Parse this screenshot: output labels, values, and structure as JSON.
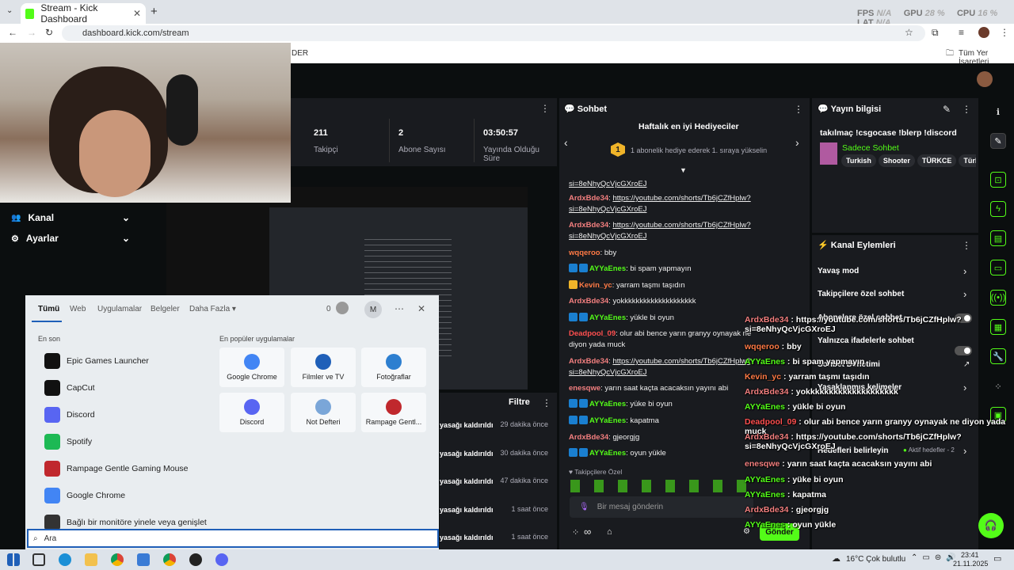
{
  "browser": {
    "tab_title": "Stream - Kick Dashboard",
    "url": "dashboard.kick.com/stream",
    "bookmarks_label": "Tüm Yer İşaretleri",
    "bookmark_fragment": "DER"
  },
  "perf_overlay": {
    "fps_label": "FPS",
    "fps_value": "N/A",
    "gpu_label": "GPU",
    "gpu_value": "28 %",
    "cpu_label": "CPU",
    "cpu_value": "16 %",
    "lat_label": "LAT",
    "lat_value": "N/A"
  },
  "stats": [
    {
      "value": "211",
      "label": "Takipçi"
    },
    {
      "value": "2",
      "label": "Abone Sayısı"
    },
    {
      "value": "03:50:57",
      "label": "Yayında Olduğu Süre"
    }
  ],
  "sidebar": {
    "items": [
      {
        "label": "Kanal",
        "icon": "people-icon"
      },
      {
        "label": "Ayarlar",
        "icon": "gear-icon"
      }
    ]
  },
  "activity": {
    "filter_label": "Filtre",
    "rows": [
      {
        "text": "yasağı kaldırıldı",
        "time": "29 dakika önce"
      },
      {
        "text": "yasağı kaldırıldı",
        "time": "30 dakika önce"
      },
      {
        "text": "yasağı kaldırıldı",
        "time": "47 dakika önce"
      },
      {
        "text": "yasağı kaldırıldı",
        "time": "1 saat önce"
      },
      {
        "text": "yasağı kaldırıldı",
        "time": "1 saat önce"
      }
    ]
  },
  "chat": {
    "title": "Sohbet",
    "gifters_title": "Haftalık en iyi Hediyeciler",
    "gifters_rank": "1",
    "gifters_text": "1 abonelik hediye ederek 1. sıraya yükselin",
    "messages": [
      {
        "user": "",
        "text": "si=8eNhyQcVjcGXroEJ",
        "link": true
      },
      {
        "user": "ArdxBde34",
        "text": "https://youtube.com/shorts/Tb6jCZfHplw?si=8eNhyQcVjcGXroEJ",
        "link": true
      },
      {
        "user": "ArdxBde34",
        "text": "https://youtube.com/shorts/Tb6jCZfHplw?si=8eNhyQcVjcGXroEJ",
        "link": true
      },
      {
        "user": "wqqeroo",
        "text": "bby"
      },
      {
        "user": "AYYaEnes",
        "text": "bi spam yapmayın"
      },
      {
        "user": "Kevin_yc",
        "text": "yarram taşmı taşıdın"
      },
      {
        "user": "ArdxBde34",
        "text": "yokkkkkkkkkkkkkkkkkkkk"
      },
      {
        "user": "AYYaEnes",
        "text": "yükle bi oyun"
      },
      {
        "user": "Deadpool_09",
        "text": "olur abi bence yarın granyy oynayak ne diyon yada muck"
      },
      {
        "user": "ArdxBde34",
        "text": "https://youtube.com/shorts/Tb6jCZfHplw?si=8eNhyQcVjcGXroEJ",
        "link": true
      },
      {
        "user": "enesqwe",
        "text": "yarın saat kaçta acacaksın yayını abi"
      },
      {
        "user": "AYYaEnes",
        "text": "yüke bi oyun"
      },
      {
        "user": "AYYaEnes",
        "text": "kapatma"
      },
      {
        "user": "ArdxBde34",
        "text": "gjeorgjg"
      },
      {
        "user": "AYYaEnes",
        "text": "oyun yükle"
      }
    ],
    "followers_only": "Takipçilere Özel",
    "input_placeholder": "Bir mesaj gönderin",
    "send_label": "Gönder",
    "infinity": "∞"
  },
  "stream_info": {
    "title": "Yayın bilgisi",
    "stream_title": "takılmaç !csgocase !blerp !discord",
    "category": "Sadece Sohbet",
    "tags": [
      "Turkish",
      "Shooter",
      "TÜRKCE",
      "Türk"
    ]
  },
  "channel_actions": {
    "title": "Kanal Eylemleri",
    "items": [
      {
        "label": "Yavaş mod"
      },
      {
        "label": "Takipçilere özel sohbet"
      },
      {
        "label": "Abonelere özel sohbet"
      },
      {
        "label": "Yalnızca ifadelerle sohbet"
      },
      {
        "label": "Sohbet Denetimi"
      },
      {
        "label": "Yasaklanmış kelimeler"
      },
      {
        "label": "Hedefleri belirleyin"
      }
    ],
    "active_goals": "Aktif hedefler - 2"
  },
  "overlay_chat": [
    {
      "user": "ArdxBde34",
      "text": "https://youtube.com/shorts/Tb6jCZfHplw?si=8eNhyQcVjcGXroEJ"
    },
    {
      "user": "wqqeroo",
      "text": "bby"
    },
    {
      "user": "AYYaEnes",
      "text": "bi spam yapmayın"
    },
    {
      "user": "Kevin_yc",
      "text": "yarram taşmı taşıdın"
    },
    {
      "user": "ArdxBde34",
      "text": "yokkkkkkkkkkkkkkkkkkkk"
    },
    {
      "user": "AYYaEnes",
      "text": "yükle bi oyun"
    },
    {
      "user": "Deadpool_09",
      "text": "olur abi bence yarın granyy oynayak ne diyon yada muck"
    },
    {
      "user": "ArdxBde34",
      "text": "https://youtube.com/shorts/Tb6jCZfHplw?si=8eNhyQcVjcGXroEJ"
    },
    {
      "user": "enesqwe",
      "text": "yarın saat kaçta acacaksın yayını abi"
    },
    {
      "user": "AYYaEnes",
      "text": "yüke bi oyun"
    },
    {
      "user": "AYYaEnes",
      "text": "kapatma"
    },
    {
      "user": "ArdxBde34",
      "text": "gjeorgjg"
    },
    {
      "user": "AYYaEnes",
      "text": "oyun yükle"
    }
  ],
  "start_menu": {
    "tabs": [
      "Tümü",
      "Web",
      "Uygulamalar",
      "Belgeler",
      "Daha Fazla"
    ],
    "points": "0",
    "avatar_letter": "M",
    "recent_header": "En son",
    "recent": [
      "Epic Games Launcher",
      "CapCut",
      "Discord",
      "Spotify",
      "Rampage Gentle Gaming Mouse",
      "Google Chrome",
      "Bağlı bir monitöre yinele veya genişlet"
    ],
    "popular_header": "En popüler uygulamalar",
    "popular": [
      "Google Chrome",
      "Filmler ve TV",
      "Fotoğraflar",
      "Discord",
      "Not Defteri",
      "Rampage Gentl..."
    ],
    "search_placeholder": "Ara"
  },
  "taskbar": {
    "weather": "16°C  Çok bulutlu",
    "time": "23:41",
    "date": "21.11.2025"
  }
}
